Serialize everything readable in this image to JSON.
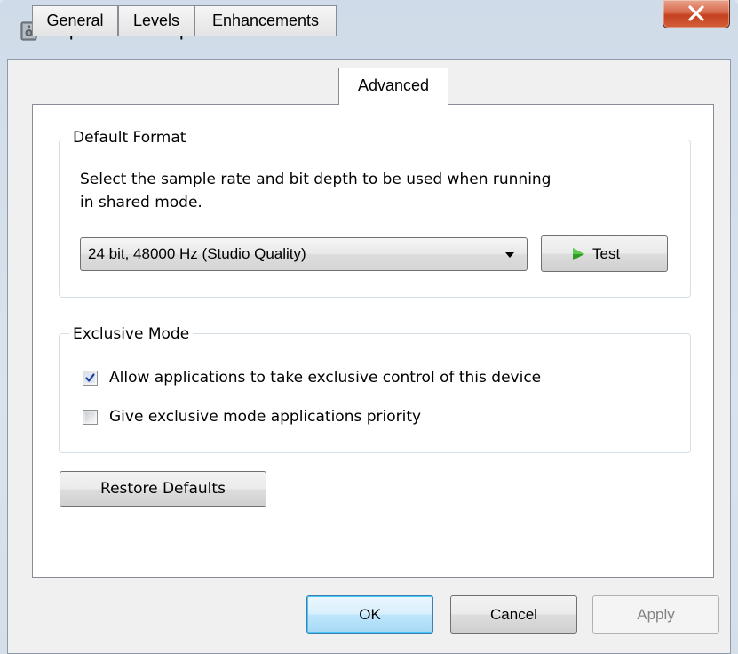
{
  "window": {
    "title": "Speakers Properties",
    "title_icon": "speaker-icon",
    "close_icon": "close-icon"
  },
  "tabs": [
    {
      "label": "General",
      "active": false
    },
    {
      "label": "Levels",
      "active": false
    },
    {
      "label": "Enhancements",
      "active": false
    },
    {
      "label": "Advanced",
      "active": true
    }
  ],
  "default_format": {
    "title": "Default Format",
    "description_line1": "Select the sample rate and bit depth to be used when running",
    "description_line2": "in shared mode.",
    "selected_format": "24 bit, 48000 Hz (Studio Quality)",
    "test_label": "Test",
    "test_icon": "play-icon"
  },
  "exclusive_mode": {
    "title": "Exclusive Mode",
    "options": [
      {
        "label": "Allow applications to take exclusive control of this device",
        "checked": true
      },
      {
        "label": "Give exclusive mode applications priority",
        "checked": false
      }
    ]
  },
  "restore_label": "Restore Defaults",
  "buttons": {
    "ok": "OK",
    "cancel": "Cancel",
    "apply": "Apply"
  },
  "colors": {
    "close_button": "#c4401f",
    "default_button_border": "#3c7fb1",
    "checkmark": "#1b3ea0",
    "play_icon": "#2f9c24"
  }
}
